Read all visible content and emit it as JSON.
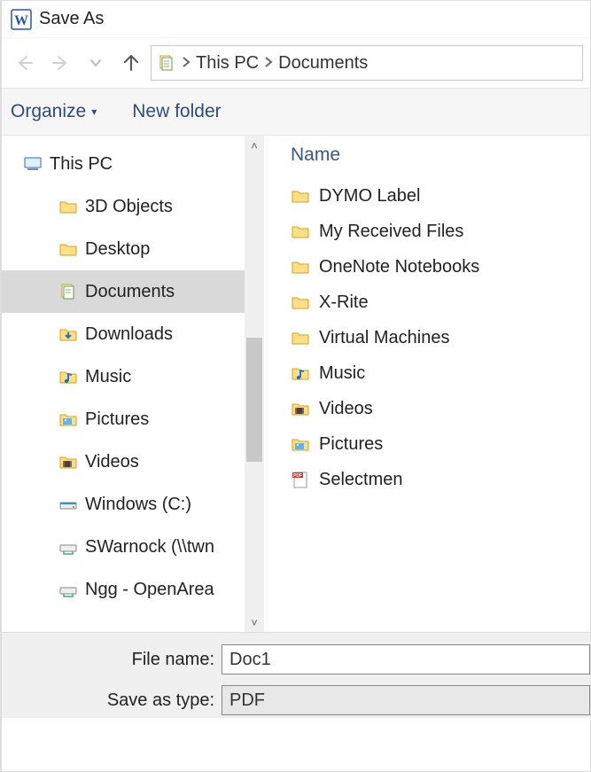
{
  "window": {
    "title": "Save As"
  },
  "breadcrumb": {
    "root": "This PC",
    "folder": "Documents"
  },
  "toolbar": {
    "organize": "Organize",
    "newfolder": "New folder"
  },
  "tree": {
    "root": "This PC",
    "items": [
      {
        "label": "3D Objects",
        "icon": "folder"
      },
      {
        "label": "Desktop",
        "icon": "folder"
      },
      {
        "label": "Documents",
        "icon": "documents",
        "selected": true
      },
      {
        "label": "Downloads",
        "icon": "downloads"
      },
      {
        "label": "Music",
        "icon": "music"
      },
      {
        "label": "Pictures",
        "icon": "pictures"
      },
      {
        "label": "Videos",
        "icon": "videos"
      },
      {
        "label": "Windows (C:)",
        "icon": "drive"
      },
      {
        "label": "SWarnock (\\\\twn",
        "icon": "netdrive"
      },
      {
        "label": "Ngg - OpenArea",
        "icon": "netdrive"
      }
    ]
  },
  "list": {
    "col_name": "Name",
    "rows": [
      {
        "label": "DYMO Label",
        "icon": "folder"
      },
      {
        "label": "My Received Files",
        "icon": "folder"
      },
      {
        "label": "OneNote Notebooks",
        "icon": "folder"
      },
      {
        "label": "X-Rite",
        "icon": "folder"
      },
      {
        "label": "Virtual Machines",
        "icon": "folder"
      },
      {
        "label": "Music",
        "icon": "music"
      },
      {
        "label": "Videos",
        "icon": "videos"
      },
      {
        "label": "Pictures",
        "icon": "pictures"
      },
      {
        "label": "Selectmen",
        "icon": "pdf"
      }
    ]
  },
  "form": {
    "filename_label": "File name:",
    "filename_value": "Doc1",
    "savetype_label": "Save as type:",
    "savetype_value": "PDF"
  }
}
